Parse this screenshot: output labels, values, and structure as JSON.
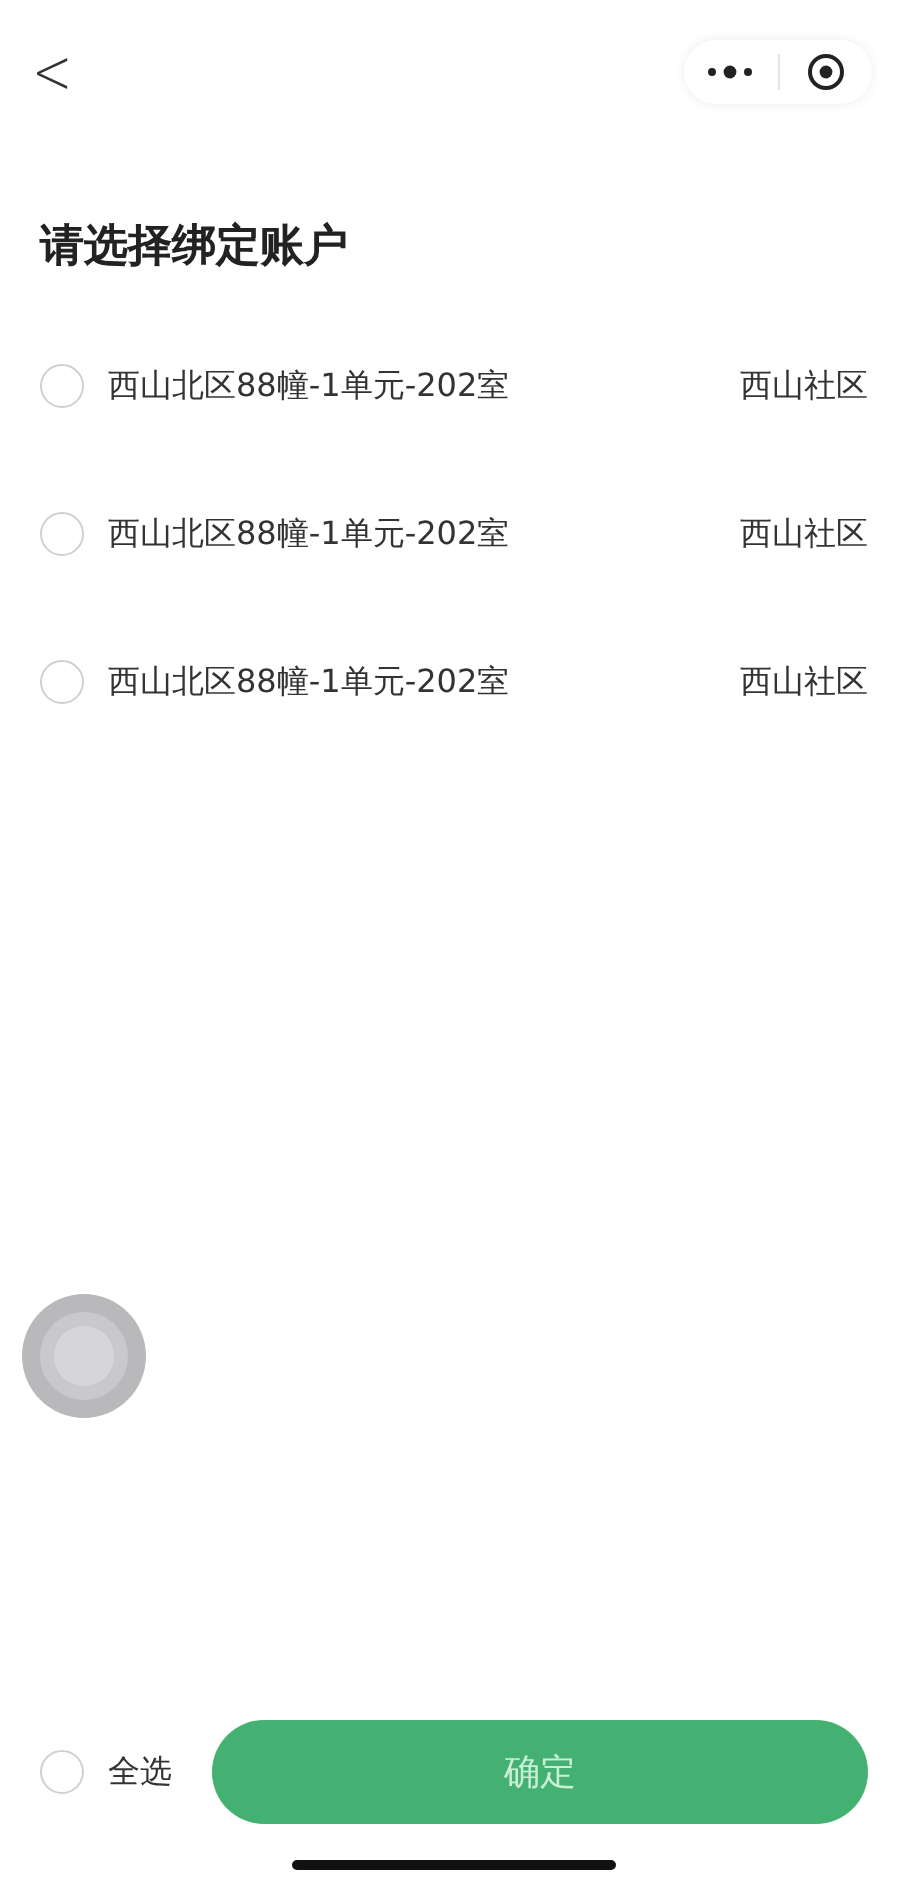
{
  "nav": {
    "back": "<"
  },
  "title": "请选择绑定账户",
  "accounts": [
    {
      "address": "西山北区88幢-1单元-202室",
      "community": "西山社区",
      "selected": false
    },
    {
      "address": "西山北区88幢-1单元-202室",
      "community": "西山社区",
      "selected": false
    },
    {
      "address": "西山北区88幢-1单元-202室",
      "community": "西山社区",
      "selected": false
    }
  ],
  "select_all": {
    "label": "全选",
    "checked": false
  },
  "confirm_button": "确定"
}
